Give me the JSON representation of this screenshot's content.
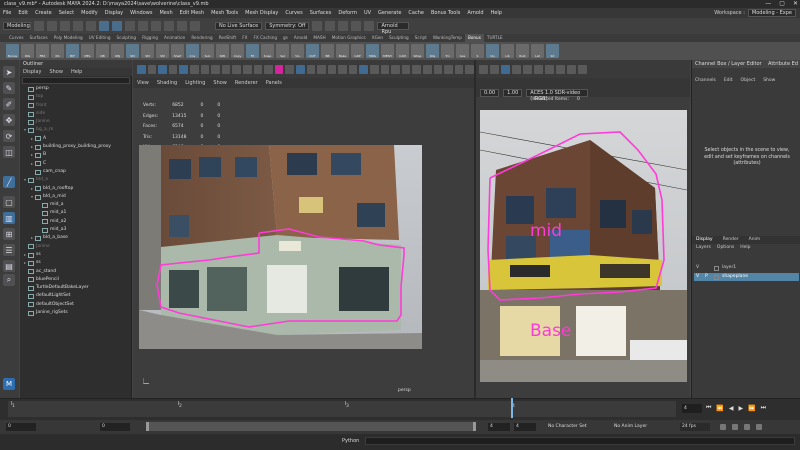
{
  "window": {
    "title": "class_v9.mb* - Autodesk MAYA 2024.2: D:\\maya2024\\save\\wolverine\\class_v9.mb",
    "controls": [
      "—",
      "▢",
      "✕"
    ]
  },
  "menubar": {
    "items": [
      "File",
      "Edit",
      "Create",
      "Select",
      "Modify",
      "Display",
      "Windows",
      "Mesh",
      "Edit Mesh",
      "Mesh Tools",
      "Mesh Display",
      "Curves",
      "Surfaces",
      "Deform",
      "UV",
      "Generate",
      "Cache",
      "Bonus Tools",
      "Arnold",
      "Help"
    ],
    "workspace_label": "Workspace :",
    "workspace_value": "Modeling - Expe"
  },
  "statusline": {
    "mode": "Modeling",
    "live_surface": "No Live Surface",
    "symmetry": "Symmetry: Off",
    "renderer": "Arnold Rpu"
  },
  "shelf_tabs": {
    "tabs": [
      "Curves",
      "Surfaces",
      "Poly Modeling",
      "UV Editing",
      "Sculpting",
      "Rigging",
      "Animation",
      "Rendering",
      "RedShift",
      "FX",
      "FX Caching",
      "gs",
      "Arnold",
      "MASH",
      "Motion Graphics",
      "XGen",
      "Sculpting",
      "Script",
      "WankingTemp",
      "Bonus",
      "TURTLE"
    ],
    "active_index": 19
  },
  "shelf": {
    "items": [
      "Bonus",
      "IDG",
      "FBX",
      "RS",
      "BIF",
      "MEL",
      "NB",
      "OBJ",
      "SM",
      "SM",
      "SM",
      "Shelf",
      "Cnv",
      "Sub",
      "SPR",
      "Copy",
      "Fit",
      "Snap",
      "Sel",
      "Vis",
      "OUT",
      "BB",
      "Bake",
      "GRP",
      "MRG",
      "MESH",
      "CAM",
      "Wrap",
      "RIG",
      "Trn",
      "Gss",
      "S",
      "Vis",
      "Lib",
      "RvIk",
      "Lat",
      "SX"
    ]
  },
  "outliner": {
    "title": "Outliner",
    "menu": [
      "Display",
      "Show",
      "Help"
    ],
    "items": [
      {
        "label": "persp",
        "depth": 0,
        "dim": false,
        "arrow": ""
      },
      {
        "label": "top",
        "depth": 0,
        "dim": true,
        "arrow": ""
      },
      {
        "label": "front",
        "depth": 0,
        "dim": true,
        "arrow": ""
      },
      {
        "label": "side",
        "depth": 0,
        "dim": true,
        "arrow": ""
      },
      {
        "label": "Janine",
        "depth": 0,
        "dim": true,
        "arrow": ""
      },
      {
        "label": "bg_a_m",
        "depth": 0,
        "dim": true,
        "arrow": "▾"
      },
      {
        "label": "A",
        "depth": 1,
        "dim": false,
        "arrow": "▸"
      },
      {
        "label": "building_proxy_building_proxy",
        "depth": 1,
        "dim": false,
        "arrow": "▸"
      },
      {
        "label": "B",
        "depth": 1,
        "dim": false,
        "arrow": "▸"
      },
      {
        "label": "C",
        "depth": 1,
        "dim": false,
        "arrow": "▸"
      },
      {
        "label": "cam_cnap",
        "depth": 1,
        "dim": false,
        "arrow": ""
      },
      {
        "label": "bld_a",
        "depth": 0,
        "dim": true,
        "arrow": "▾"
      },
      {
        "label": "bld_a_rooftop",
        "depth": 1,
        "dim": false,
        "arrow": "▸"
      },
      {
        "label": "bld_a_mid",
        "depth": 1,
        "dim": false,
        "arrow": "▾"
      },
      {
        "label": "mid_a",
        "depth": 2,
        "dim": false,
        "arrow": ""
      },
      {
        "label": "mid_a1",
        "depth": 2,
        "dim": false,
        "arrow": ""
      },
      {
        "label": "mid_a2",
        "depth": 2,
        "dim": false,
        "arrow": ""
      },
      {
        "label": "mid_a3",
        "depth": 2,
        "dim": false,
        "arrow": ""
      },
      {
        "label": "bld_a_base",
        "depth": 1,
        "dim": false,
        "arrow": "▸"
      },
      {
        "label": "Janine",
        "depth": 0,
        "dim": true,
        "arrow": ""
      },
      {
        "label": "ss",
        "depth": 0,
        "dim": false,
        "arrow": "▸"
      },
      {
        "label": "ss",
        "depth": 0,
        "dim": false,
        "arrow": "▸"
      },
      {
        "label": "ac_stand",
        "depth": 0,
        "dim": false,
        "arrow": ""
      },
      {
        "label": "bluePencil",
        "depth": 0,
        "dim": false,
        "arrow": ""
      },
      {
        "label": "TurtleDefaultBakeLayer",
        "depth": 0,
        "dim": false,
        "arrow": ""
      },
      {
        "label": "defaultLightSet",
        "depth": 0,
        "dim": false,
        "arrow": ""
      },
      {
        "label": "defaultObjectSet",
        "depth": 0,
        "dim": false,
        "arrow": ""
      },
      {
        "label": "Janine_rigSets",
        "depth": 0,
        "dim": false,
        "arrow": ""
      }
    ]
  },
  "viewport1": {
    "menu": [
      "View",
      "Shading",
      "Lighting",
      "Show",
      "Renderer",
      "Panels"
    ],
    "hud": [
      {
        "label": "Verts:",
        "a": "6852",
        "b": "0",
        "c": "0"
      },
      {
        "label": "Edges:",
        "a": "13415",
        "b": "0",
        "c": "0"
      },
      {
        "label": "Faces:",
        "a": "6574",
        "b": "0",
        "c": "0"
      },
      {
        "label": "Tris:",
        "a": "13148",
        "b": "0",
        "c": "0"
      },
      {
        "label": "UVs:",
        "a": "8546",
        "b": "0",
        "c": "0"
      }
    ],
    "camera_label": "persp",
    "annotation_color": "#ff3bd8"
  },
  "viewport2": {
    "exposure": "0.00",
    "gamma": "1.00",
    "colorspace": "ACES 1.0 SDR-video (sRGB)",
    "selected_items_label": "Selected Items:",
    "selected_items_value": "0",
    "annotation_mid": "mid",
    "annotation_base": "Base",
    "annotation_color": "#ff3bd8"
  },
  "channelbox": {
    "title": "Channel Box / Layer Editor",
    "attr_editor": "Attribute Ed",
    "menu": [
      "Channels",
      "Edit",
      "Object",
      "Show"
    ],
    "message": "Select objects in the scene to view, edit and set keyframes on channels (attributes)",
    "layer_tabs": [
      "Display",
      "Render",
      "Anim"
    ],
    "layer_menu": [
      "Layers",
      "Options",
      "Help"
    ],
    "layers": [
      {
        "name": "layer1",
        "v": "V",
        "p": "",
        "selected": false
      },
      {
        "name": "shapeplane",
        "v": "V",
        "p": "P",
        "selected": true
      }
    ]
  },
  "timeline": {
    "ticks": [
      "1",
      "2",
      "3",
      "4"
    ],
    "current_frame": "4",
    "controls": [
      "⏮",
      "⏪",
      "◀",
      "▶",
      "⏩",
      "⏭"
    ]
  },
  "range": {
    "start": "0",
    "inner_start": "0",
    "inner_end": "4",
    "end": "4",
    "character_set": "No Character Set",
    "anim_layer": "No Anim Layer",
    "fps": "24 fps"
  },
  "cmdline": {
    "language": "Python"
  }
}
